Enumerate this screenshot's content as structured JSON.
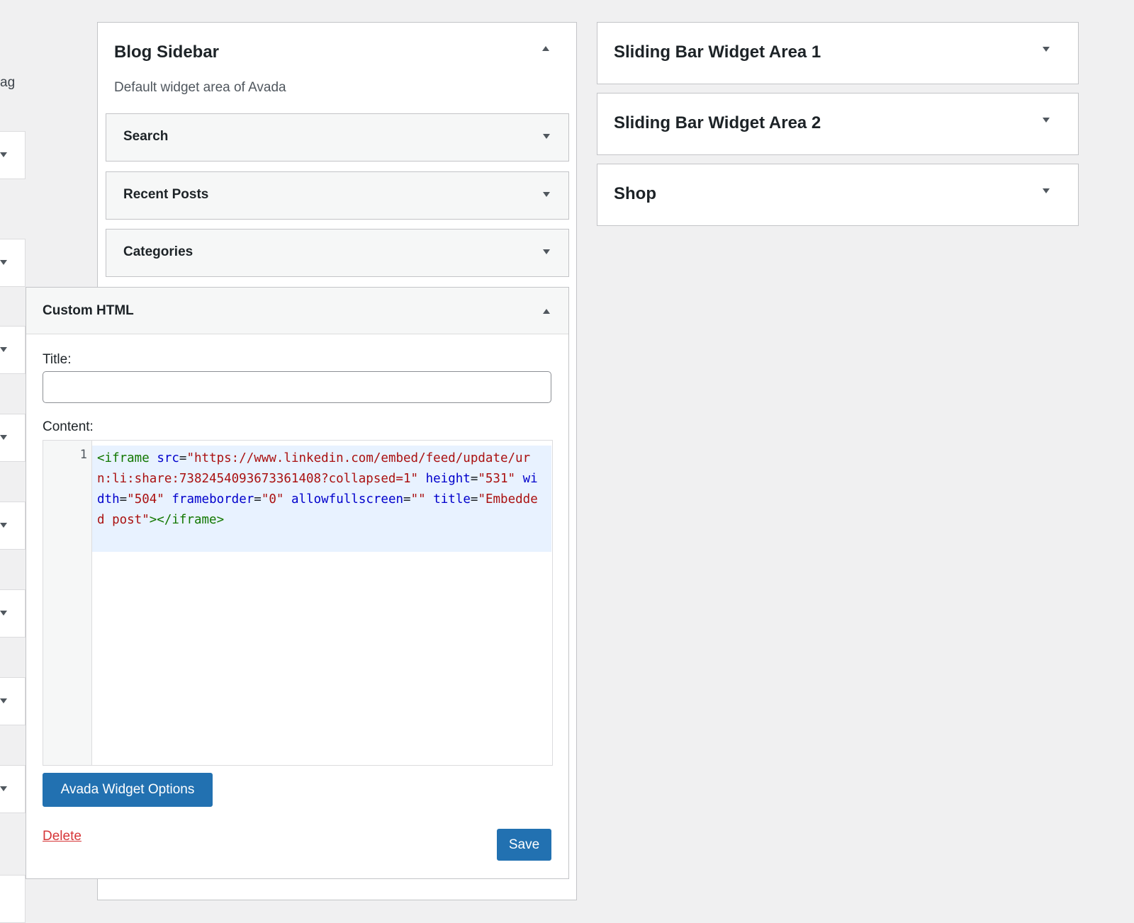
{
  "left_column": {
    "partial_label": "ag"
  },
  "blog_sidebar": {
    "title": "Blog Sidebar",
    "description": "Default widget area of Avada",
    "widgets": [
      {
        "label": "Search"
      },
      {
        "label": "Recent Posts"
      },
      {
        "label": "Categories"
      }
    ]
  },
  "custom_html_widget": {
    "title": "Custom HTML",
    "title_field_label": "Title:",
    "title_field_value": "",
    "content_field_label": "Content:",
    "line_number": "1",
    "code": {
      "tag_open": "<iframe",
      "attr_src": "src",
      "val_src": "\"https://www.linkedin.com/embed/feed/update/urn:li:share:7382454093673361408?collapsed=1\"",
      "attr_height": "height",
      "val_height": "\"531\"",
      "attr_width": "width",
      "val_width": "\"504\"",
      "attr_frameborder": "frameborder",
      "val_frameborder": "\"0\"",
      "attr_allowfullscreen": "allowfullscreen",
      "val_allowfullscreen": "\"\"",
      "attr_title": "title",
      "val_title": "\"Embedded post\"",
      "tag_close": "></iframe>"
    },
    "options_button": "Avada Widget Options",
    "delete_link": "Delete",
    "save_button": "Save"
  },
  "widget_areas": [
    {
      "title": "Sliding Bar Widget Area 1"
    },
    {
      "title": "Sliding Bar Widget Area 2"
    },
    {
      "title": "Shop"
    }
  ],
  "colors": {
    "background": "#f0f0f1",
    "primary_button": "#2271b1",
    "delete_link": "#d63638"
  }
}
